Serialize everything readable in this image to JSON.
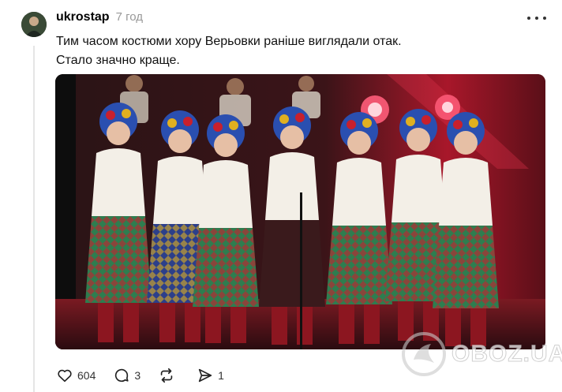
{
  "post": {
    "username": "ukrostap",
    "time": "7 год",
    "text_line1": "Тим часом костюми хору Верьовки раніше виглядали отак.",
    "text_line2": "Стало значно краще."
  },
  "actions": {
    "likes": "604",
    "replies": "3",
    "reposts": "",
    "shares": "1"
  },
  "watermark": {
    "text": "OBOZ.UA"
  },
  "icons": {
    "more": "more-icon",
    "like": "heart-icon",
    "reply": "comment-icon",
    "repost": "repost-icon",
    "share": "send-icon"
  },
  "colors": {
    "stage_red": "#c8202d",
    "wreath_blue": "#2a4fb0",
    "costume_green": "#2e7d4f"
  }
}
